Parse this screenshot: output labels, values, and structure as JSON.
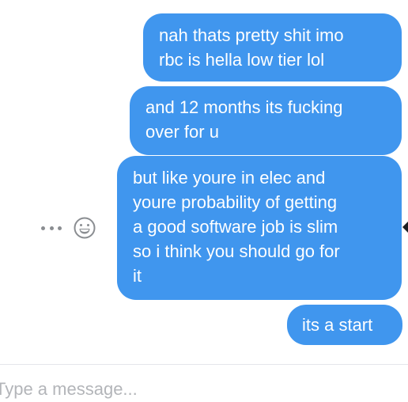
{
  "conversation": {
    "messages": [
      {
        "text": "nah thats pretty shit imo\nrbc is hella low tier lol",
        "sender": "me"
      },
      {
        "text": "and 12 months its fucking\nover for u",
        "sender": "me"
      },
      {
        "text": "but like youre in elec and\nyoure probability of getting\na good software job is slim\nso i think you should go for\nit",
        "sender": "me"
      },
      {
        "text": "its a start",
        "sender": "me"
      }
    ],
    "hover_actions": {
      "more_icon": "more-horizontal-icon",
      "react_icon": "smiley-face-icon"
    }
  },
  "composer": {
    "placeholder": "Type a message..."
  },
  "theme": {
    "bubble_color": "#4096ee",
    "bubble_text_color": "#ffffff",
    "icon_color": "#8a8d91"
  }
}
